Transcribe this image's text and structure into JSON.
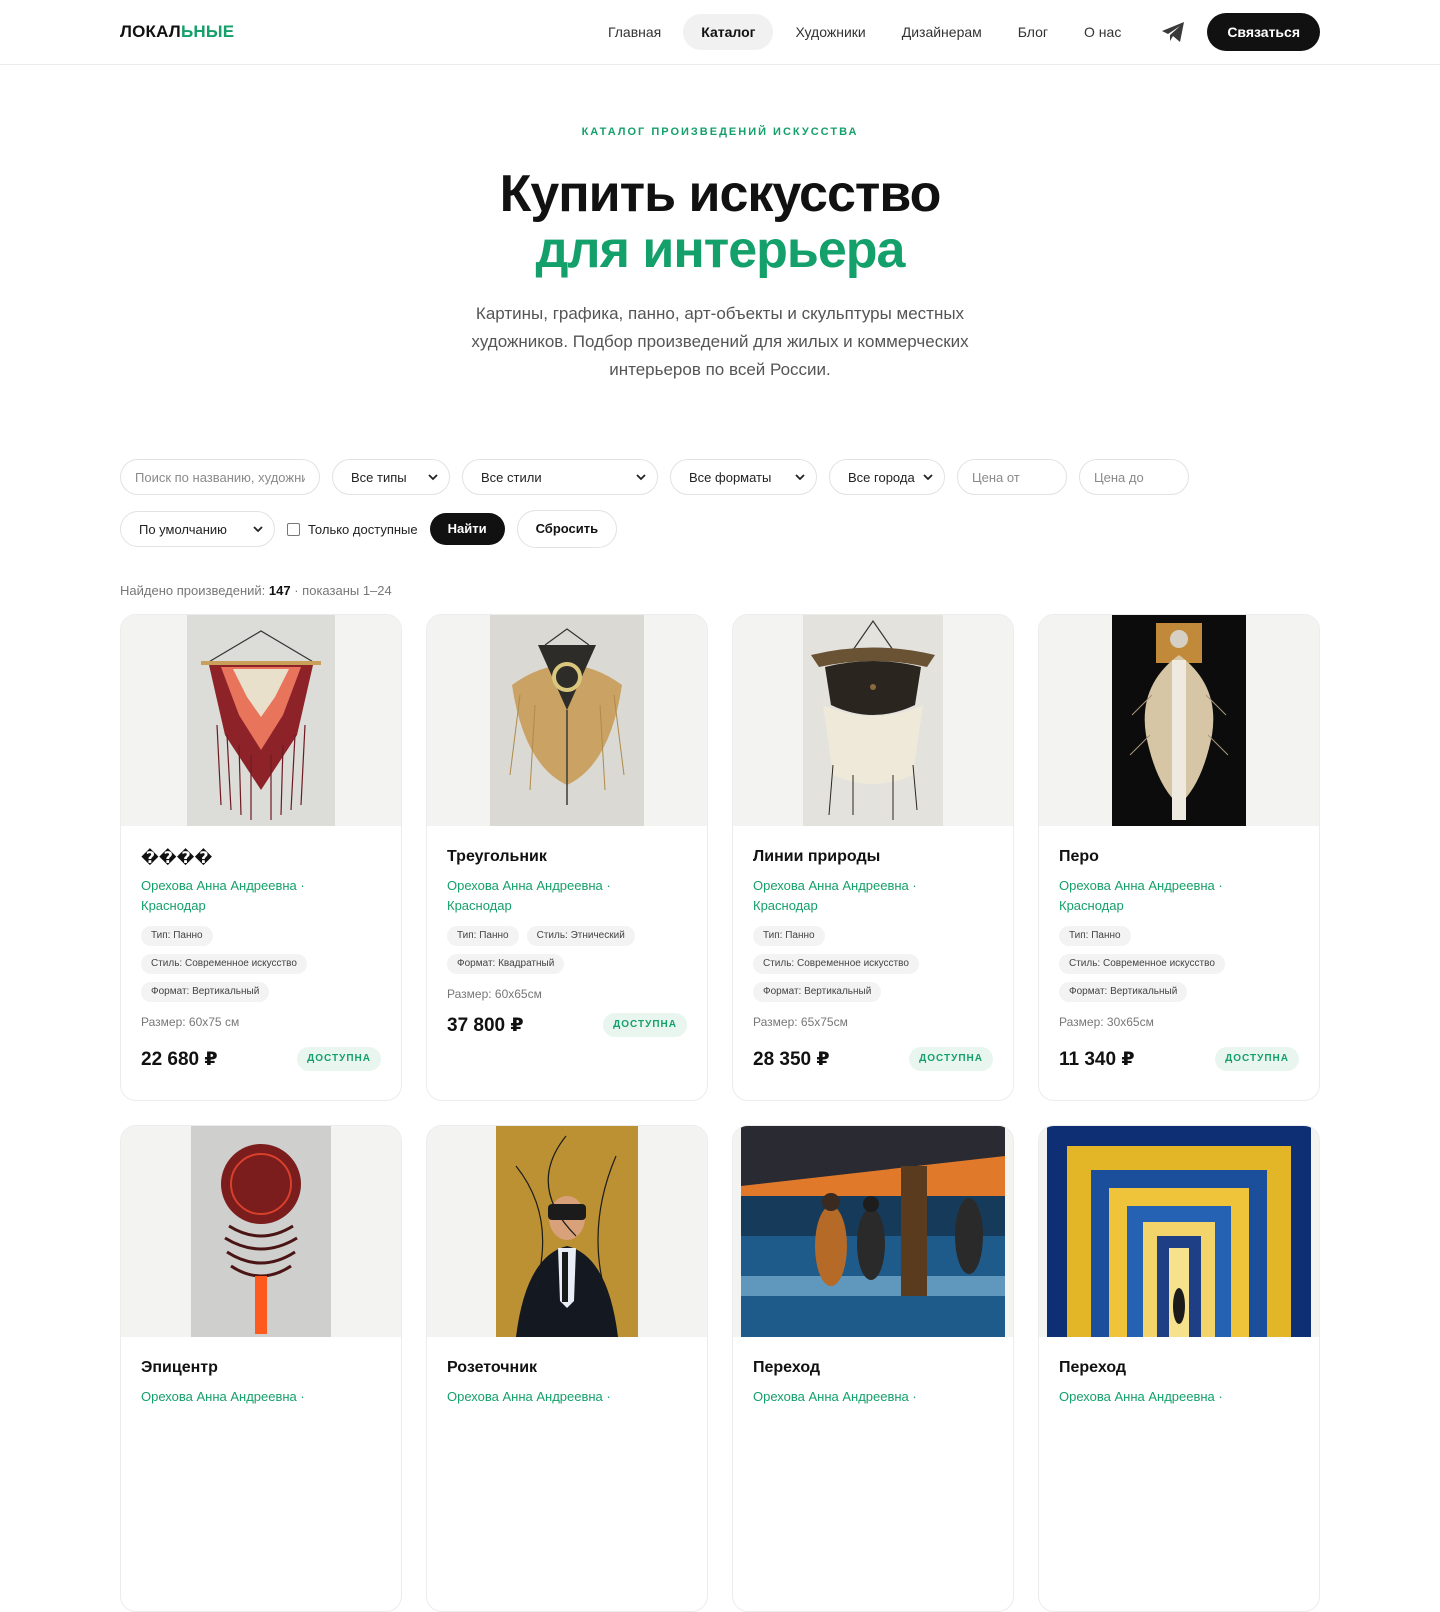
{
  "brand": {
    "part1": "ЛОКАЛ",
    "part2": "ЬНЫЕ"
  },
  "nav": {
    "items": [
      "Главная",
      "Каталог",
      "Художники",
      "Дизайнерам",
      "Блог",
      "О нас"
    ],
    "active": "Каталог",
    "telegram_icon": "telegram-plane-icon",
    "contact_label": "Связаться"
  },
  "hero": {
    "eyebrow": "КАТАЛОГ ПРОИЗВЕДЕНИЙ ИСКУССТВА",
    "title_line1": "Купить искусство",
    "title_line2": "для интерьера",
    "lead": "Картины, графика, панно, арт-объекты и скульптуры местных художников. Подбор произведений для жилых и коммерческих интерьеров по всей России."
  },
  "filters": {
    "search_placeholder": "Поиск по названию, художнику",
    "type": "Все типы",
    "style": "Все стили",
    "format": "Все форматы",
    "city": "Все города",
    "price_from_placeholder": "Цена от",
    "price_to_placeholder": "Цена до",
    "sort": "По умолчанию",
    "only_available": "Только доступные",
    "find": "Найти",
    "reset": "Сбросить"
  },
  "results": {
    "label": "Найдено произведений:",
    "count": "147",
    "shown": "· показаны 1–24"
  },
  "colors": {
    "accent": "#14a06a",
    "dark": "#111111"
  },
  "cards": [
    {
      "title": "����",
      "author": "Орехова Анна Андреевна ·",
      "city": "Краснодар",
      "tags": [
        "Тип: Панно",
        "Стиль: Современное искусство",
        "Формат: Вертикальный"
      ],
      "size": "Размер: 60x75 см",
      "price": "22 680 ₽",
      "status": "ДОСТУПНА"
    },
    {
      "title": "Треугольник",
      "author": "Орехова Анна Андреевна ·",
      "city": "Краснодар",
      "tags": [
        "Тип: Панно",
        "Стиль: Этнический",
        "Формат: Квадратный"
      ],
      "size": "Размер: 60x65см",
      "price": "37 800 ₽",
      "status": "ДОСТУПНА"
    },
    {
      "title": "Линии природы",
      "author": "Орехова Анна Андреевна ·",
      "city": "Краснодар",
      "tags": [
        "Тип: Панно",
        "Стиль: Современное искусство",
        "Формат: Вертикальный"
      ],
      "size": "Размер: 65x75см",
      "price": "28 350 ₽",
      "status": "ДОСТУПНА"
    },
    {
      "title": "Перо",
      "author": "Орехова Анна Андреевна ·",
      "city": "Краснодар",
      "tags": [
        "Тип: Панно",
        "Стиль: Современное искусство",
        "Формат: Вертикальный"
      ],
      "size": "Размер: 30x65см",
      "price": "11 340 ₽",
      "status": "ДОСТУПНА"
    },
    {
      "title": "Эпицентр",
      "author": "Орехова Анна Андреевна ·"
    },
    {
      "title": "Розеточник",
      "author": "Орехова Анна Андреевна ·"
    },
    {
      "title": "Переход",
      "author": "Орехова Анна Андреевна ·"
    },
    {
      "title": "Переход",
      "author": "Орехова Анна Андреевна ·"
    }
  ]
}
